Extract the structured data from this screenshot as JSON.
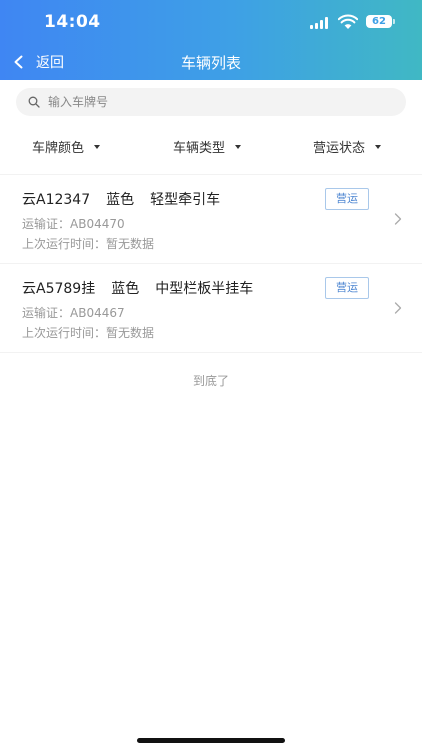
{
  "status": {
    "time": "14:04",
    "battery": "62"
  },
  "nav": {
    "back_label": "返回",
    "title": "车辆列表"
  },
  "search": {
    "placeholder": "输入车牌号",
    "value": ""
  },
  "filters": [
    {
      "label": "车牌颜色"
    },
    {
      "label": "车辆类型"
    },
    {
      "label": "营运状态"
    }
  ],
  "vehicles": [
    {
      "plate": "云A12347",
      "color": "蓝色",
      "type": "轻型牵引车",
      "status": "营运",
      "permit_label": "运输证：",
      "permit": "AB04470",
      "last_run_label": "上次运行时间：",
      "last_run": "暂无数据"
    },
    {
      "plate": "云A5789挂",
      "color": "蓝色",
      "type": "中型栏板半挂车",
      "status": "营运",
      "permit_label": "运输证：",
      "permit": "AB04467",
      "last_run_label": "上次运行时间：",
      "last_run": "暂无数据"
    }
  ],
  "footer": {
    "end_text": "到底了"
  },
  "colors": {
    "header_start": "#3f86f3",
    "header_end": "#40b8c4",
    "badge_text": "#4d86d1",
    "badge_border": "#a9c8ea"
  },
  "icons": {
    "back": "chevron-left-icon",
    "search": "search-icon",
    "row": "chevron-right-icon",
    "filter": "caret-down-icon"
  }
}
